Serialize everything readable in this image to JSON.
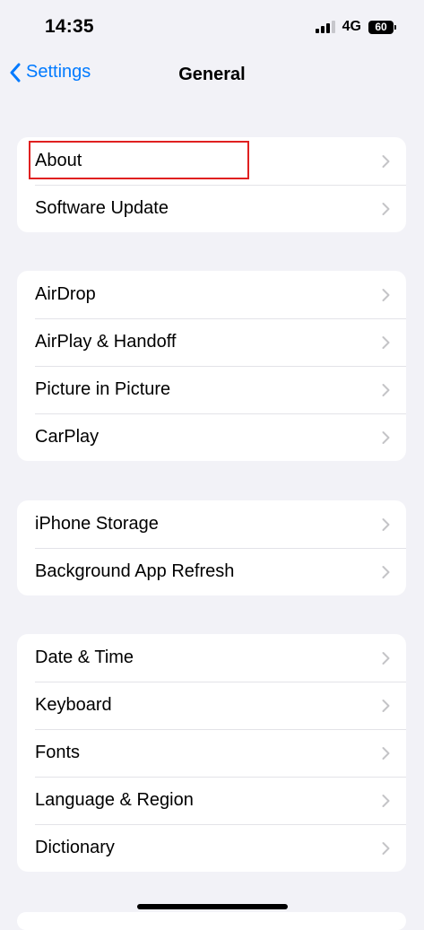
{
  "status_bar": {
    "time": "14:35",
    "network": "4G",
    "battery": "60"
  },
  "nav": {
    "back_label": "Settings",
    "title": "General"
  },
  "groups": [
    {
      "items": [
        {
          "label": "About"
        },
        {
          "label": "Software Update"
        }
      ]
    },
    {
      "items": [
        {
          "label": "AirDrop"
        },
        {
          "label": "AirPlay & Handoff"
        },
        {
          "label": "Picture in Picture"
        },
        {
          "label": "CarPlay"
        }
      ]
    },
    {
      "items": [
        {
          "label": "iPhone Storage"
        },
        {
          "label": "Background App Refresh"
        }
      ]
    },
    {
      "items": [
        {
          "label": "Date & Time"
        },
        {
          "label": "Keyboard"
        },
        {
          "label": "Fonts"
        },
        {
          "label": "Language & Region"
        },
        {
          "label": "Dictionary"
        }
      ]
    }
  ],
  "colors": {
    "accent": "#007AFF",
    "background": "#F2F2F7",
    "highlight": "#E02020"
  }
}
